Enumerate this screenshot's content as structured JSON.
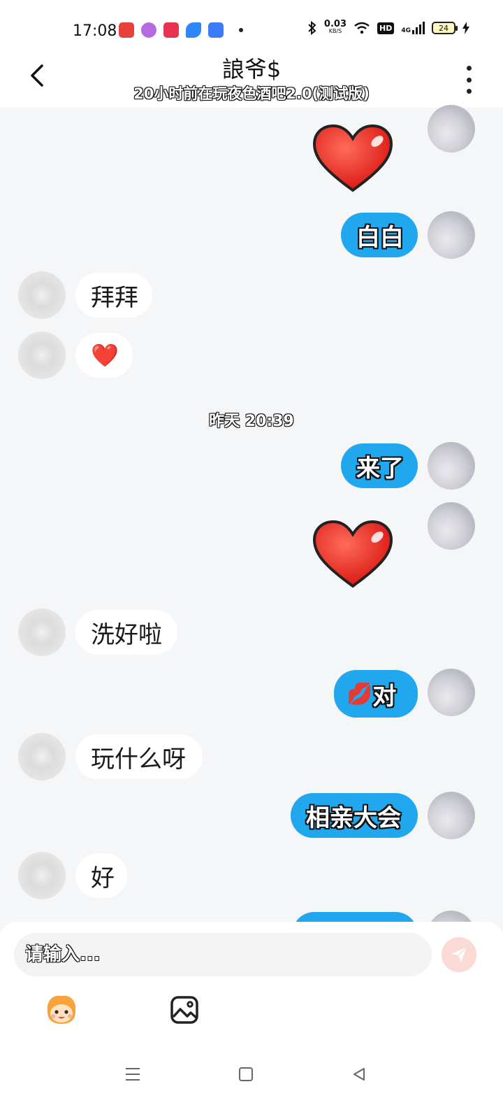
{
  "status_bar": {
    "time": "17:08",
    "net_speed": "0.03",
    "net_unit": "KB/S",
    "hd": "HD",
    "signal": "4G",
    "battery": "24",
    "app_icon_colors": [
      "#e8413b",
      "#b46ce0",
      "#e8324f",
      "#2f86f6",
      "#3b7cf6"
    ]
  },
  "header": {
    "title": "誏爷$",
    "subtitle": "20小时前在玩夜色酒吧2.0(测试版)"
  },
  "messages": {
    "m1": {
      "sender": "me",
      "kind": "heart-sticker"
    },
    "m2": {
      "sender": "me",
      "text": "白白"
    },
    "m3": {
      "sender": "other",
      "text": "拜拜"
    },
    "m4": {
      "sender": "other",
      "text": "❤️"
    },
    "timestamp": "昨天 20:39",
    "m5": {
      "sender": "me",
      "text": "来了"
    },
    "m6": {
      "sender": "me",
      "kind": "heart-sticker"
    },
    "m7": {
      "sender": "other",
      "text": "洗好啦"
    },
    "m8": {
      "sender": "me",
      "emoji": "💋",
      "text": "对"
    },
    "m9": {
      "sender": "other",
      "text": "玩什么呀"
    },
    "m10": {
      "sender": "me",
      "text": "相亲大会"
    },
    "m11": {
      "sender": "other",
      "text": "好"
    }
  },
  "composer": {
    "placeholder": "请输入...",
    "emoji_icon": "emoji-face-icon",
    "image_icon": "image-icon",
    "send_icon": "send-icon"
  },
  "colors": {
    "my_bubble": "#21a7ee",
    "their_bubble": "#ffffff",
    "background": "#f4f6f8",
    "send_button": "#fbd9d4"
  }
}
